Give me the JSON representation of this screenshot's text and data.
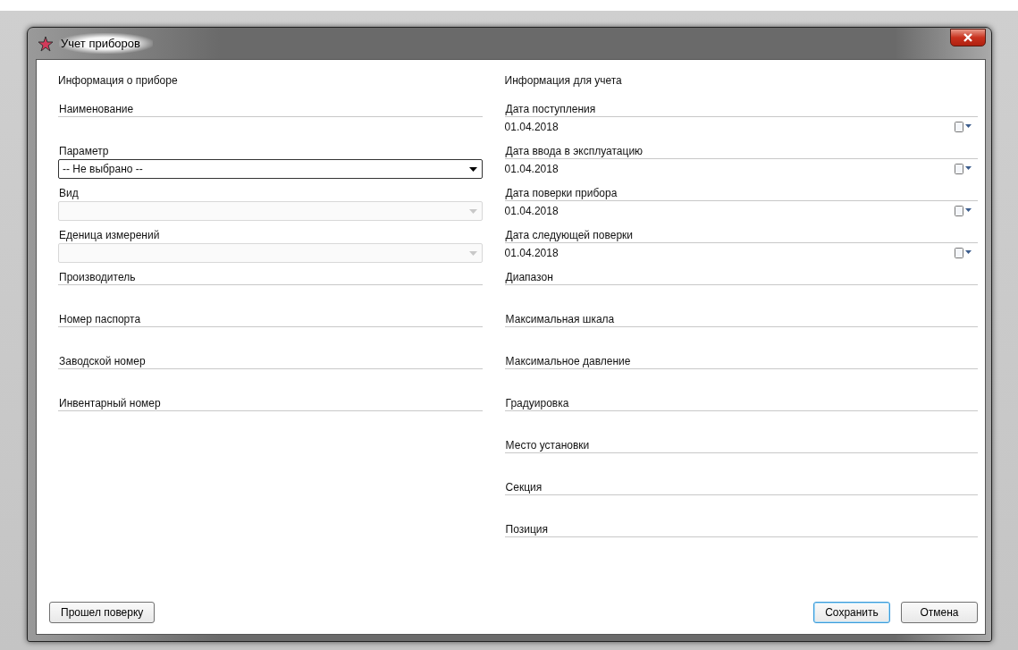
{
  "window": {
    "title": "Учет приборов"
  },
  "left": {
    "heading": "Информация о приборе",
    "fields": [
      {
        "kind": "text",
        "label": "Наименование"
      },
      {
        "kind": "combo",
        "label": "Параметр",
        "value": "-- Не выбрано --",
        "disabled": false
      },
      {
        "kind": "combo",
        "label": "Вид",
        "disabled": true
      },
      {
        "kind": "combo",
        "label": "Еденица измерений",
        "disabled": true
      },
      {
        "kind": "text",
        "label": "Производитель"
      },
      {
        "kind": "text",
        "label": "Номер паспорта"
      },
      {
        "kind": "text",
        "label": "Заводской номер"
      },
      {
        "kind": "text",
        "label": "Инвентарный номер"
      }
    ]
  },
  "right": {
    "heading": "Информация для учета",
    "fields": [
      {
        "kind": "date",
        "label": "Дата поступления",
        "value": "01.04.2018"
      },
      {
        "kind": "date",
        "label": "Дата ввода в эксплуатацию",
        "value": "01.04.2018"
      },
      {
        "kind": "date",
        "label": "Дата поверки прибора",
        "value": "01.04.2018"
      },
      {
        "kind": "date",
        "label": "Дата следующей поверки",
        "value": "01.04.2018"
      },
      {
        "kind": "text",
        "label": "Диапазон"
      },
      {
        "kind": "text",
        "label": "Максимальная шкала"
      },
      {
        "kind": "text",
        "label": "Максимальное давление"
      },
      {
        "kind": "text",
        "label": "Градуировка"
      },
      {
        "kind": "text",
        "label": "Место установки"
      },
      {
        "kind": "text",
        "label": "Секция"
      },
      {
        "kind": "text",
        "label": "Позиция"
      }
    ]
  },
  "buttons_left": [
    {
      "label": "Прошел поверку",
      "focused": false
    }
  ],
  "buttons_right": [
    {
      "label": "Сохранить",
      "focused": true
    },
    {
      "label": "Отмена",
      "focused": false
    }
  ]
}
